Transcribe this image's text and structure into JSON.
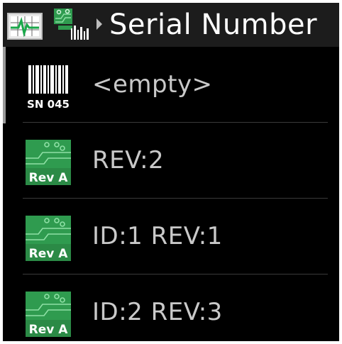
{
  "header": {
    "title": "Serial Number",
    "left_icon": "monitor-pulse-icon",
    "device_icon": "circuit-board-barcode-icon",
    "separator_icon": "breadcrumb-arrow-icon"
  },
  "list": {
    "items": [
      {
        "label": "<empty>",
        "icon": "barcode-icon",
        "icon_text": "SN 045"
      },
      {
        "label": "REV:2",
        "icon": "circuit-board-icon",
        "icon_text": "Rev A"
      },
      {
        "label": "ID:1 REV:1",
        "icon": "circuit-board-icon",
        "icon_text": "Rev A"
      },
      {
        "label": "ID:2 REV:3",
        "icon": "circuit-board-icon",
        "icon_text": "Rev A"
      }
    ]
  },
  "colors": {
    "background": "#000000",
    "titlebar": "#1c1c1c",
    "text": "#c9c9c9",
    "board_green": "#2f9b4f",
    "board_light": "#6fcf8a"
  }
}
